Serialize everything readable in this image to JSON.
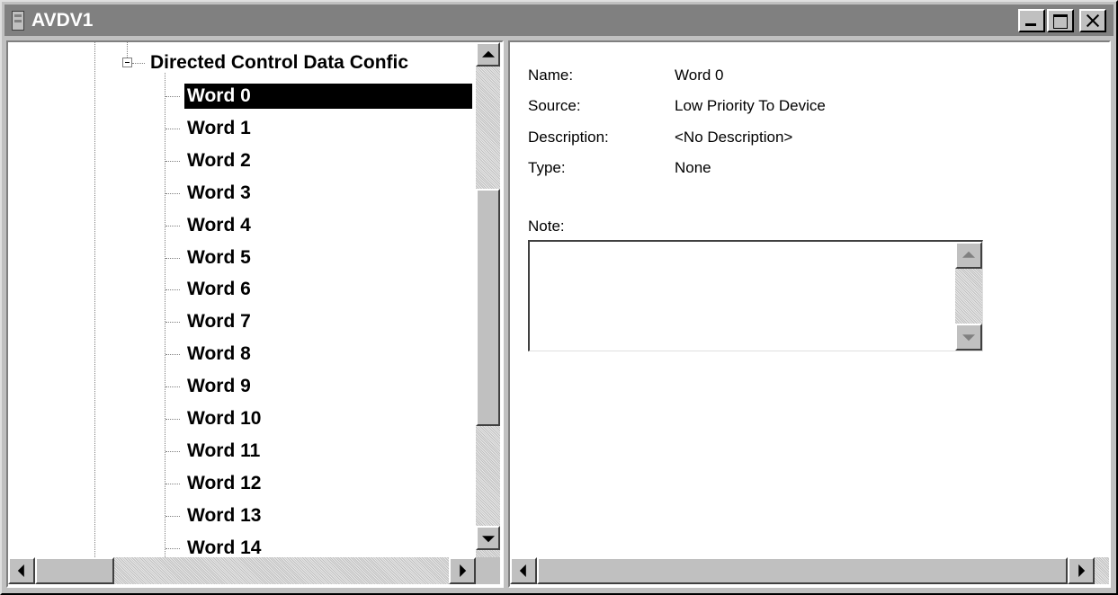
{
  "window": {
    "title": "AVDV1",
    "controls": [
      "minimize",
      "maximize",
      "close"
    ]
  },
  "tree": {
    "parent_label": "Directed Control Data Confic",
    "parent_expanded": true,
    "items": [
      "Word 0",
      "Word 1",
      "Word 2",
      "Word 3",
      "Word 4",
      "Word 5",
      "Word 6",
      "Word 7",
      "Word 8",
      "Word 9",
      "Word 10",
      "Word 11",
      "Word 12",
      "Word 13",
      "Word 14"
    ],
    "selected_item": "Word 0"
  },
  "details": {
    "name_label": "Name:",
    "name_value": "Word 0",
    "source_label": "Source:",
    "source_value": "Low Priority To Device",
    "description_label": "Description:",
    "description_value": "<No Description>",
    "type_label": "Type:",
    "type_value": "None",
    "note_label": "Note:",
    "note_value": ""
  },
  "colors": {
    "face": "#c0c0c0",
    "title_inactive": "#808080",
    "selection": "#000000",
    "background": "#ffffff"
  }
}
